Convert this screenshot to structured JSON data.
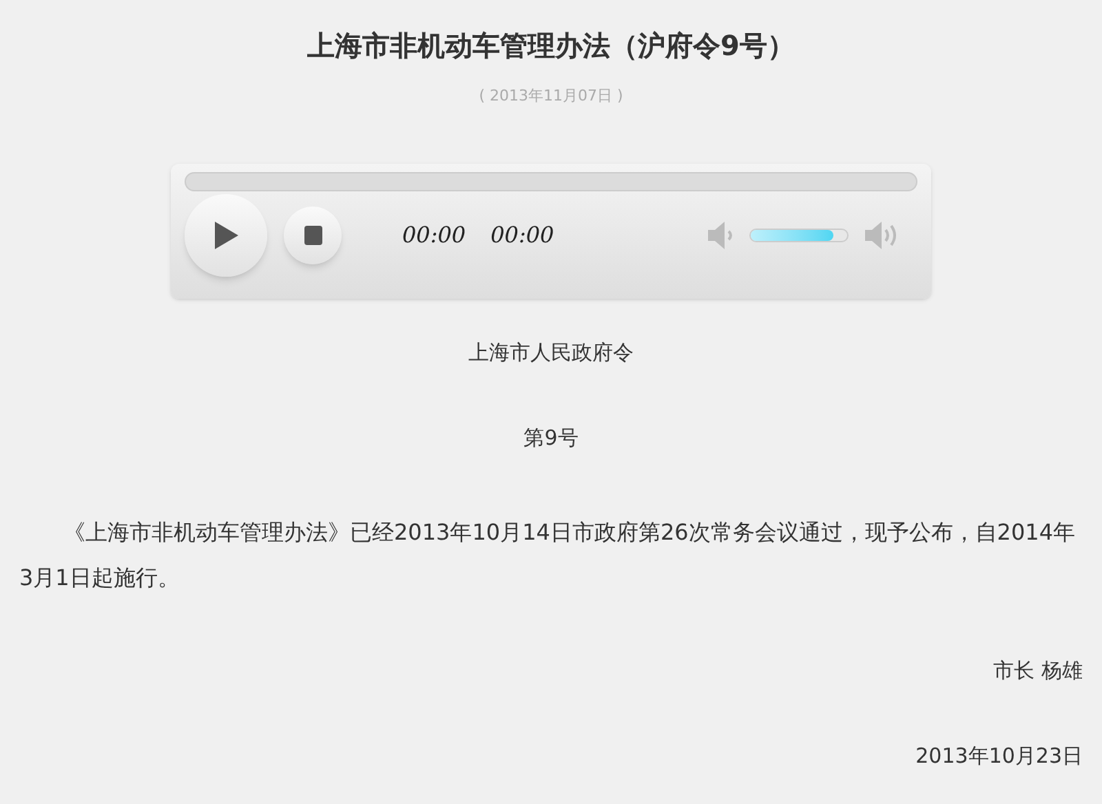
{
  "title": "上海市非机动车管理办法（沪府令9号）",
  "date": "( 2013年11月07日 )",
  "player": {
    "elapsed": "00:00",
    "duration": "00:00",
    "volume": {
      "level": 0.85
    }
  },
  "body": [
    {
      "kind": "center",
      "text": "上海市人民政府令"
    },
    {
      "kind": "center",
      "text": "第9号"
    },
    {
      "kind": "paragraph",
      "text": "《上海市非机动车管理办法》已经2013年10月14日市政府第26次常务会议通过，现予公布，自2014年3月1日起施行。"
    },
    {
      "kind": "right",
      "text": "市长 杨雄"
    },
    {
      "kind": "right",
      "text": "2013年10月23日"
    }
  ]
}
